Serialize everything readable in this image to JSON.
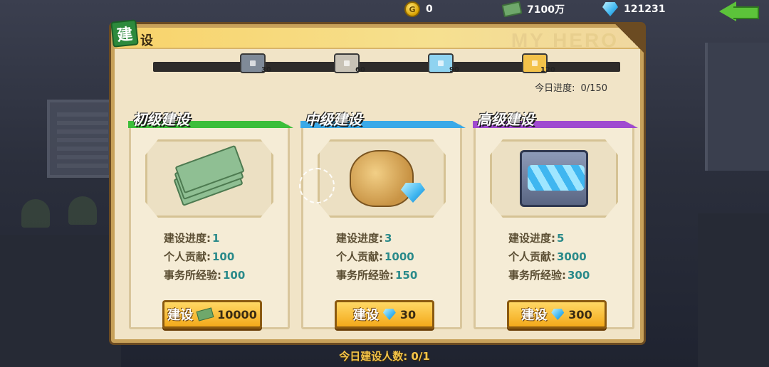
{
  "topbar": {
    "coins": "0",
    "cash": "7100万",
    "gems": "121231"
  },
  "panel": {
    "title_badge": "建",
    "title_rest": "设",
    "bg_text": "MY HERO"
  },
  "progress": {
    "chest_thresholds": [
      "30",
      "60",
      "90",
      "120"
    ],
    "chest_colors": [
      "#7f8a98",
      "#c8c2b6",
      "#8fd3f0",
      "#f3c24a"
    ],
    "today_label": "今日进度:",
    "today_value": "0/150"
  },
  "cards": [
    {
      "tier": "初级建设",
      "stripe_color": "#3cbe3a",
      "stat_progress_label": "建设进度:",
      "stat_progress_value": "1",
      "stat_contribution_label": "个人贡献:",
      "stat_contribution_value": "100",
      "stat_exp_label": "事务所经验:",
      "stat_exp_value": "100",
      "button_label": "建设",
      "button_cost": "10000",
      "cost_icon": "cash-icon"
    },
    {
      "tier": "中级建设",
      "stripe_color": "#3aa9e8",
      "stat_progress_label": "建设进度:",
      "stat_progress_value": "3",
      "stat_contribution_label": "个人贡献:",
      "stat_contribution_value": "1000",
      "stat_exp_label": "事务所经验:",
      "stat_exp_value": "150",
      "button_label": "建设",
      "button_cost": "30",
      "cost_icon": "gem-icon"
    },
    {
      "tier": "高级建设",
      "stripe_color": "#a04ad0",
      "stat_progress_label": "建设进度:",
      "stat_progress_value": "5",
      "stat_contribution_label": "个人贡献:",
      "stat_contribution_value": "3000",
      "stat_exp_label": "事务所经验:",
      "stat_exp_value": "300",
      "button_label": "建设",
      "button_cost": "300",
      "cost_icon": "gem-icon"
    }
  ],
  "footer": {
    "builders_today": "今日建设人数: 0/1"
  }
}
